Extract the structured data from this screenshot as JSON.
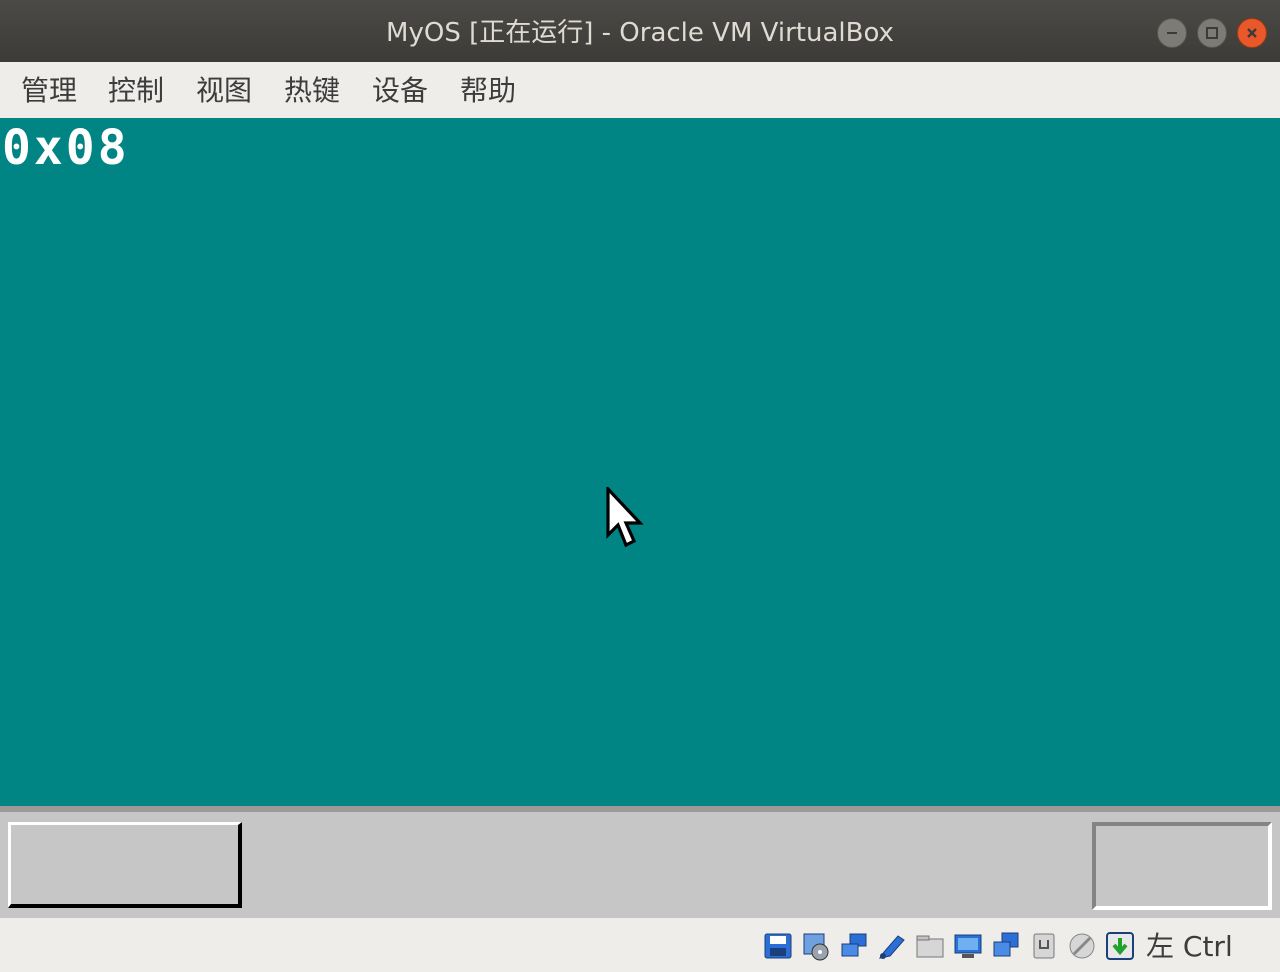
{
  "window": {
    "title": "MyOS [正在运行] - Oracle VM VirtualBox",
    "buttons": [
      "minimize",
      "maximize",
      "close"
    ]
  },
  "menu": {
    "items": [
      "管理",
      "控制",
      "视图",
      "热键",
      "设备",
      "帮助"
    ]
  },
  "vm": {
    "background_color": "#008484",
    "screen_text": "0x08"
  },
  "statusbar": {
    "icons": [
      "hard-disk-icon",
      "optical-drive-icon",
      "audio-icon",
      "network-icon",
      "usb-icon",
      "shared-folders-icon",
      "display-icon",
      "video-capture-icon",
      "cpu-icon",
      "mouse-integration-icon",
      "keyboard-capture-icon"
    ],
    "host_key": "左 Ctrl"
  }
}
